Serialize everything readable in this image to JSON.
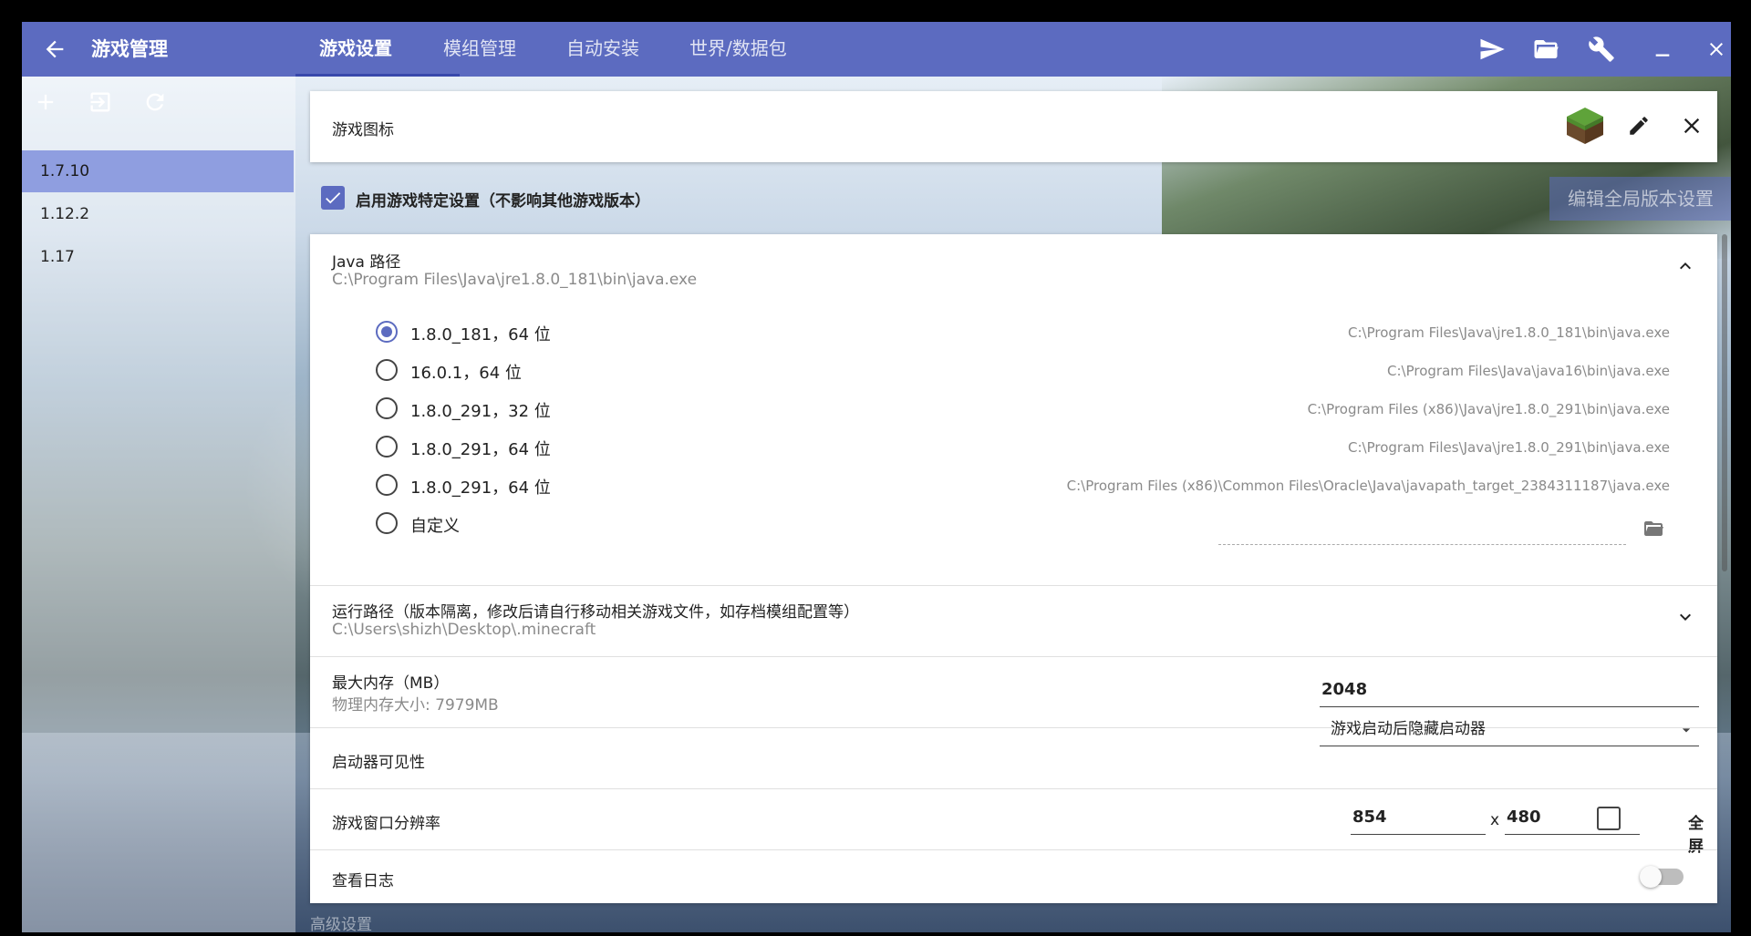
{
  "app": {
    "title": "游戏管理",
    "tabs": [
      {
        "label": "游戏设置",
        "active": true
      },
      {
        "label": "模组管理"
      },
      {
        "label": "自动安装"
      },
      {
        "label": "世界/数据包"
      }
    ],
    "toolbar_icons": [
      "paper-plane-icon",
      "folder-open-icon",
      "wrench-icon",
      "minimize-icon",
      "close-icon"
    ]
  },
  "sidebar": {
    "tools": [
      "add-icon",
      "import-icon",
      "refresh-icon"
    ],
    "versions": [
      {
        "label": "1.7.10",
        "selected": true
      },
      {
        "label": "1.12.2"
      },
      {
        "label": "1.17"
      }
    ]
  },
  "icon_card": {
    "label": "游戏图标"
  },
  "enable_specific": {
    "label": "启用游戏特定设置（不影响其他游戏版本）",
    "checked": true
  },
  "global_settings_button": "编辑全局版本设置",
  "java": {
    "label": "Java 路径",
    "current_path": "C:\\Program Files\\Java\\jre1.8.0_181\\bin\\java.exe",
    "options": [
      {
        "label": "1.8.0_181，64 位",
        "path": "C:\\Program Files\\Java\\jre1.8.0_181\\bin\\java.exe",
        "checked": true
      },
      {
        "label": "16.0.1，64 位",
        "path": "C:\\Program Files\\Java\\java16\\bin\\java.exe"
      },
      {
        "label": "1.8.0_291，32 位",
        "path": "C:\\Program Files (x86)\\Java\\jre1.8.0_291\\bin\\java.exe"
      },
      {
        "label": "1.8.0_291，64 位",
        "path": "C:\\Program Files\\Java\\jre1.8.0_291\\bin\\java.exe"
      },
      {
        "label": "1.8.0_291，64 位",
        "path": "C:\\Program Files (x86)\\Common Files\\Oracle\\Java\\javapath_target_2384311187\\java.exe"
      },
      {
        "label": "自定义",
        "path": ""
      }
    ]
  },
  "run_path": {
    "label": "运行路径（版本隔离，修改后请自行移动相关游戏文件，如存档模组配置等）",
    "value": "C:\\Users\\shizh\\Desktop\\.minecraft"
  },
  "memory": {
    "label": "最大内存（MB）",
    "sublabel": "物理内存大小: 7979MB",
    "value": "2048"
  },
  "launcher_visibility": {
    "label": "启动器可见性",
    "value": "游戏启动后隐藏启动器"
  },
  "resolution": {
    "label": "游戏窗口分辨率",
    "width": "854",
    "separator": "x",
    "height": "480",
    "fullscreen_label": "全屏",
    "fullscreen": false
  },
  "log": {
    "label": "查看日志",
    "enabled": false
  },
  "advanced_label": "高级设置",
  "colors": {
    "accent": "#5c6bc0",
    "selected_item": "#8f9ee0"
  }
}
